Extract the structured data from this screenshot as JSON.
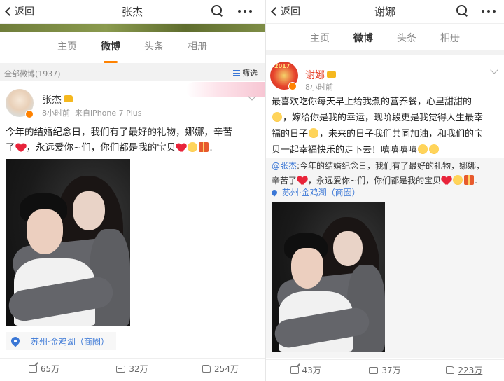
{
  "left": {
    "nav": {
      "back_label": "返回",
      "title": "张杰"
    },
    "tabs": [
      {
        "label": "主页"
      },
      {
        "label": "微博"
      },
      {
        "label": "头条"
      },
      {
        "label": "相册"
      }
    ],
    "filter": {
      "count_label": "全部微博(1937)",
      "filter_label": "筛选"
    },
    "post": {
      "user": "张杰",
      "time": "8小时前",
      "source": "来自iPhone 7 Plus",
      "text_line1": "今年的结婚纪念日，我们有了最好的礼物，娜娜，辛苦",
      "text_line2_a": "了",
      "text_line2_b": "，永远爱你~们，你们都是我的宝贝",
      "text_line2_end": ".",
      "location": "苏州·金鸡湖（商圈）",
      "actions": {
        "repost": "65万",
        "comment": "32万",
        "like": "254万"
      }
    }
  },
  "right": {
    "nav": {
      "back_label": "返回",
      "title": "谢娜"
    },
    "tabs": [
      {
        "label": "主页"
      },
      {
        "label": "微博"
      },
      {
        "label": "头条"
      },
      {
        "label": "相册"
      }
    ],
    "post": {
      "user": "谢娜",
      "time": "8小时前",
      "avatar_text": "2017",
      "text_line1": "最喜欢吃你每天早上给我煮的营养餐，心里甜甜的",
      "text_line2": "，嫁给你是我的幸运，现阶段更是我觉得人生最幸",
      "text_line3_a": "福的日子",
      "text_line3_b": "，未来的日子我们共同加油，和我们的宝",
      "text_line4": "贝一起幸福快乐的走下去！嘻嘻嘻嘻",
      "repost_at": "@张杰",
      "repost_line1": ":今年的结婚纪念日，我们有了最好的礼物，娜娜，",
      "repost_line2_a": "辛苦了",
      "repost_line2_b": "，永远爱你~们，你们都是我的宝贝",
      "repost_line2_end": ".",
      "repost_location": "苏州·金鸡湖（商圈）",
      "actions": {
        "repost": "43万",
        "comment": "37万",
        "like": "223万"
      }
    }
  },
  "colors": {
    "accent": "#ff8200",
    "link": "#3a77d6",
    "heart": "#e8243a"
  }
}
